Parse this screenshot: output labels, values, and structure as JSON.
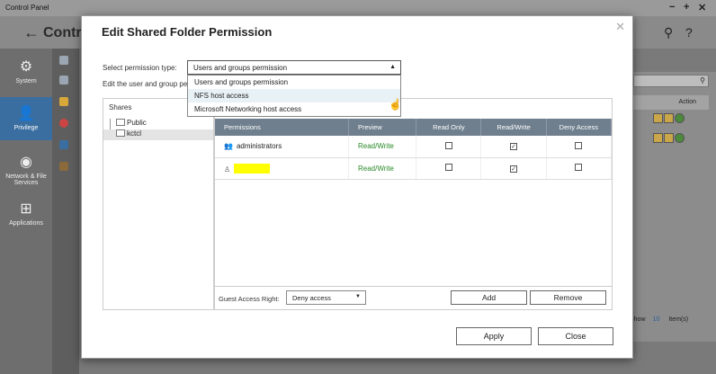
{
  "app": {
    "window_title": "Control Panel",
    "header_title": "Contr",
    "nav": [
      {
        "label": "System",
        "icon": "gear-icon"
      },
      {
        "label": "Privilege",
        "icon": "user-icon"
      },
      {
        "label": "Network & File Services",
        "icon": "globe-icon"
      },
      {
        "label": "Applications",
        "icon": "apps-icon"
      }
    ],
    "right_panel": {
      "action_header": "Action",
      "show_label": "Show",
      "show_value": "10",
      "items_label": "Item(s)"
    }
  },
  "dialog": {
    "title": "Edit Shared Folder Permission",
    "select_type_label": "Select permission type:",
    "select_type_value": "Users and groups permission",
    "edit_label": "Edit the user and group pe",
    "dropdown_options": [
      "Users and groups permission",
      "NFS host access",
      "Microsoft Networking host access"
    ],
    "shares": {
      "header": "Shares",
      "items": [
        "Public",
        "kctcl"
      ],
      "selected": "kctcl"
    },
    "permissions": {
      "columns": [
        "Permissions",
        "Preview",
        "Read Only",
        "Read/Write",
        "Deny Access"
      ],
      "rows": [
        {
          "name": "administrators",
          "preview": "Read/Write",
          "read_only": false,
          "read_write": true,
          "deny": false
        },
        {
          "name": "",
          "preview": "Read/Write",
          "read_only": false,
          "read_write": true,
          "deny": false
        }
      ],
      "guest_label": "Guest Access Right:",
      "guest_value": "Deny access",
      "add_label": "Add",
      "remove_label": "Remove"
    },
    "apply_label": "Apply",
    "close_label": "Close"
  },
  "colors": {
    "table_header": "#6f7f8e",
    "preview_green": "#2a8a2a",
    "highlight": "#e8f1f6",
    "redaction": "#ffff00",
    "nav_active": "#3a6ea0"
  }
}
